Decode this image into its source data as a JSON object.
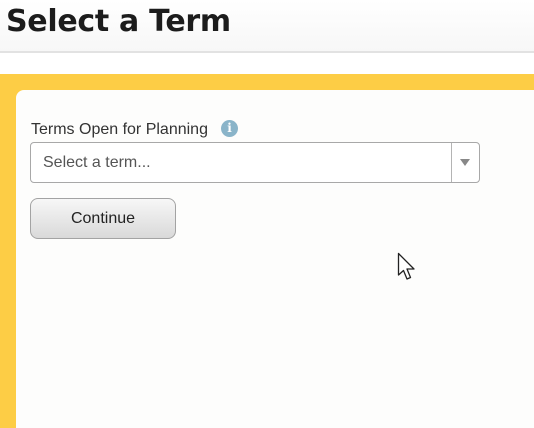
{
  "header": {
    "title": "Select a Term"
  },
  "form": {
    "term_label": "Terms Open for Planning",
    "info_icon": "info-icon",
    "term_select": {
      "placeholder": "Select a term...",
      "caret_icon": "caret-down-icon"
    },
    "continue_label": "Continue"
  },
  "colors": {
    "accent_gold": "#fdcd45",
    "info_blue": "#8ab4c9"
  }
}
